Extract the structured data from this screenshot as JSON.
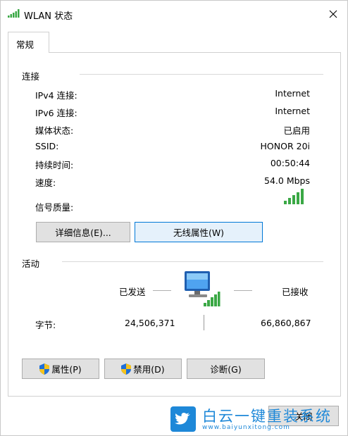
{
  "window": {
    "title": "WLAN 状态"
  },
  "tabs": [
    {
      "label": "常规"
    }
  ],
  "connection": {
    "header": "连接",
    "rows": [
      {
        "label": "IPv4 连接:",
        "value": "Internet"
      },
      {
        "label": "IPv6 连接:",
        "value": "Internet"
      },
      {
        "label": "媒体状态:",
        "value": "已启用"
      },
      {
        "label": "SSID:",
        "value": "HONOR 20i"
      },
      {
        "label": "持续时间:",
        "value": "00:50:44"
      },
      {
        "label": "速度:",
        "value": "54.0 Mbps"
      }
    ],
    "signal_label": "信号质量:",
    "signal_bars": 5,
    "details_button": "详细信息(E)...",
    "wireless_button": "无线属性(W)"
  },
  "activity": {
    "header": "活动",
    "sent_label": "已发送",
    "received_label": "已接收",
    "bytes_label": "字节:",
    "bytes_sent": "24,506,371",
    "bytes_received": "66,860,867"
  },
  "buttons": {
    "properties": "属性(P)",
    "disable": "禁用(D)",
    "diagnose": "诊断(G)",
    "close_partial": "关闭"
  },
  "watermark": {
    "brand": "白云一键重装系统",
    "url": "www.baiyunxitong.com"
  },
  "colors": {
    "accent": "#0078d7",
    "signal": "#3aa845",
    "watermark_blue": "#1e88d8"
  }
}
